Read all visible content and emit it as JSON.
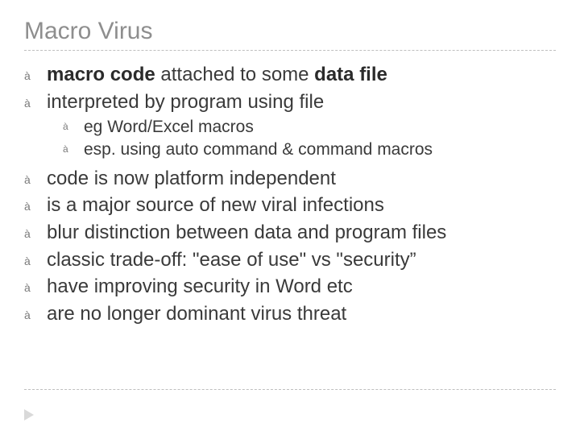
{
  "title": "Macro Virus",
  "bullets": {
    "b0_pre": "macro code",
    "b0_mid": " attached to some ",
    "b0_post": "data file",
    "b1": "interpreted by program using file",
    "s0": "eg Word/Excel macros",
    "s1": "esp. using auto command & command macros",
    "b2": "code is now platform independent",
    "b3": "is a major source of new viral infections",
    "b4": "blur distinction between data and program files",
    "b5": "classic trade-off: \"ease of use\" vs \"security”",
    "b6": "have improving security in Word etc",
    "b7": "are no longer dominant virus threat"
  },
  "marker": "à"
}
